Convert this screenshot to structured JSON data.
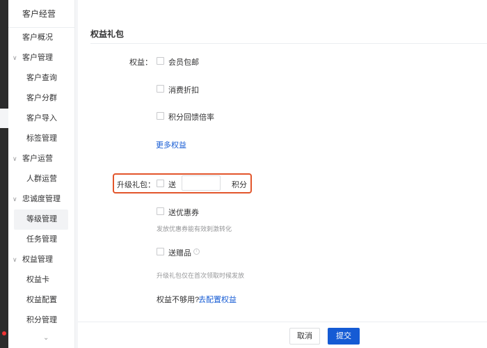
{
  "sidebar": {
    "title": "客户经营",
    "items": [
      {
        "label": "客户概况",
        "kind": "top"
      },
      {
        "label": "客户管理",
        "kind": "group"
      },
      {
        "label": "客户查询",
        "kind": "sub"
      },
      {
        "label": "客户分群",
        "kind": "sub"
      },
      {
        "label": "客户导入",
        "kind": "sub"
      },
      {
        "label": "标签管理",
        "kind": "sub"
      },
      {
        "label": "客户运营",
        "kind": "group"
      },
      {
        "label": "人群运营",
        "kind": "sub"
      },
      {
        "label": "忠诚度管理",
        "kind": "group"
      },
      {
        "label": "等级管理",
        "kind": "sub",
        "active": true
      },
      {
        "label": "任务管理",
        "kind": "sub"
      },
      {
        "label": "权益管理",
        "kind": "group"
      },
      {
        "label": "权益卡",
        "kind": "sub"
      },
      {
        "label": "权益配置",
        "kind": "sub"
      },
      {
        "label": "积分管理",
        "kind": "sub"
      }
    ],
    "more_icon": "chevron-down-icon"
  },
  "main": {
    "section_title": "权益礼包",
    "benefits_label": "权益：",
    "benefits": [
      {
        "label": "会员包邮",
        "checked": false
      },
      {
        "label": "消费折扣",
        "checked": false
      },
      {
        "label": "积分回馈倍率",
        "checked": false
      }
    ],
    "more_benefits_link": "更多权益",
    "upgrade_label": "升级礼包：",
    "give_label": "送",
    "points_value": "",
    "points_unit": "积分",
    "coupon_label": "送优惠券",
    "coupon_hint": "发放优惠券能有效刺激转化",
    "gift_label": "送赠品",
    "gift_hint": "升级礼包仅在首次领取时候发放",
    "not_enough_text": "权益不够用?",
    "configure_link": "去配置权益"
  },
  "footer": {
    "cancel_label": "取消",
    "submit_label": "提交"
  },
  "colors": {
    "accent": "#155bd4",
    "highlight": "#e2552b",
    "text": "#323233",
    "muted": "#969799"
  }
}
